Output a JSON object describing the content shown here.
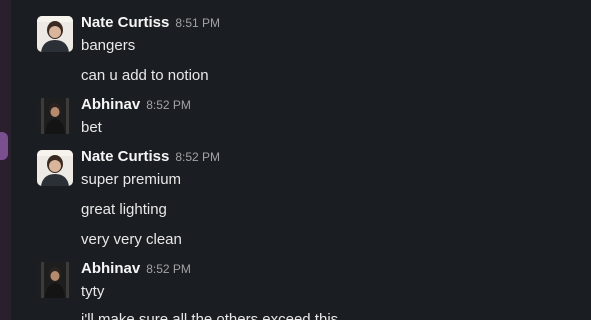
{
  "messages": [
    {
      "author": "Nate Curtiss",
      "time": "8:51 PM",
      "lines": [
        "bangers",
        "can u add to notion"
      ]
    },
    {
      "author": "Abhinav",
      "time": "8:52 PM",
      "lines": [
        "bet"
      ]
    },
    {
      "author": "Nate Curtiss",
      "time": "8:52 PM",
      "lines": [
        "super premium",
        "great lighting",
        "very very clean"
      ]
    },
    {
      "author": "Abhinav",
      "time": "8:52 PM",
      "lines": [
        "tyty",
        "i'll make sure all the others exceed this"
      ]
    }
  ],
  "colors": {
    "background": "#1a1d21",
    "sidebar": "#2a1f2d",
    "sidebar_indicator": "#7a4f8f",
    "author_text": "#f5f5f5",
    "timestamp_text": "#a1a3a6",
    "message_text": "#e8e8e8"
  },
  "icons": {
    "nate_avatar": "user-avatar-icon",
    "abhinav_avatar": "user-avatar-icon"
  }
}
